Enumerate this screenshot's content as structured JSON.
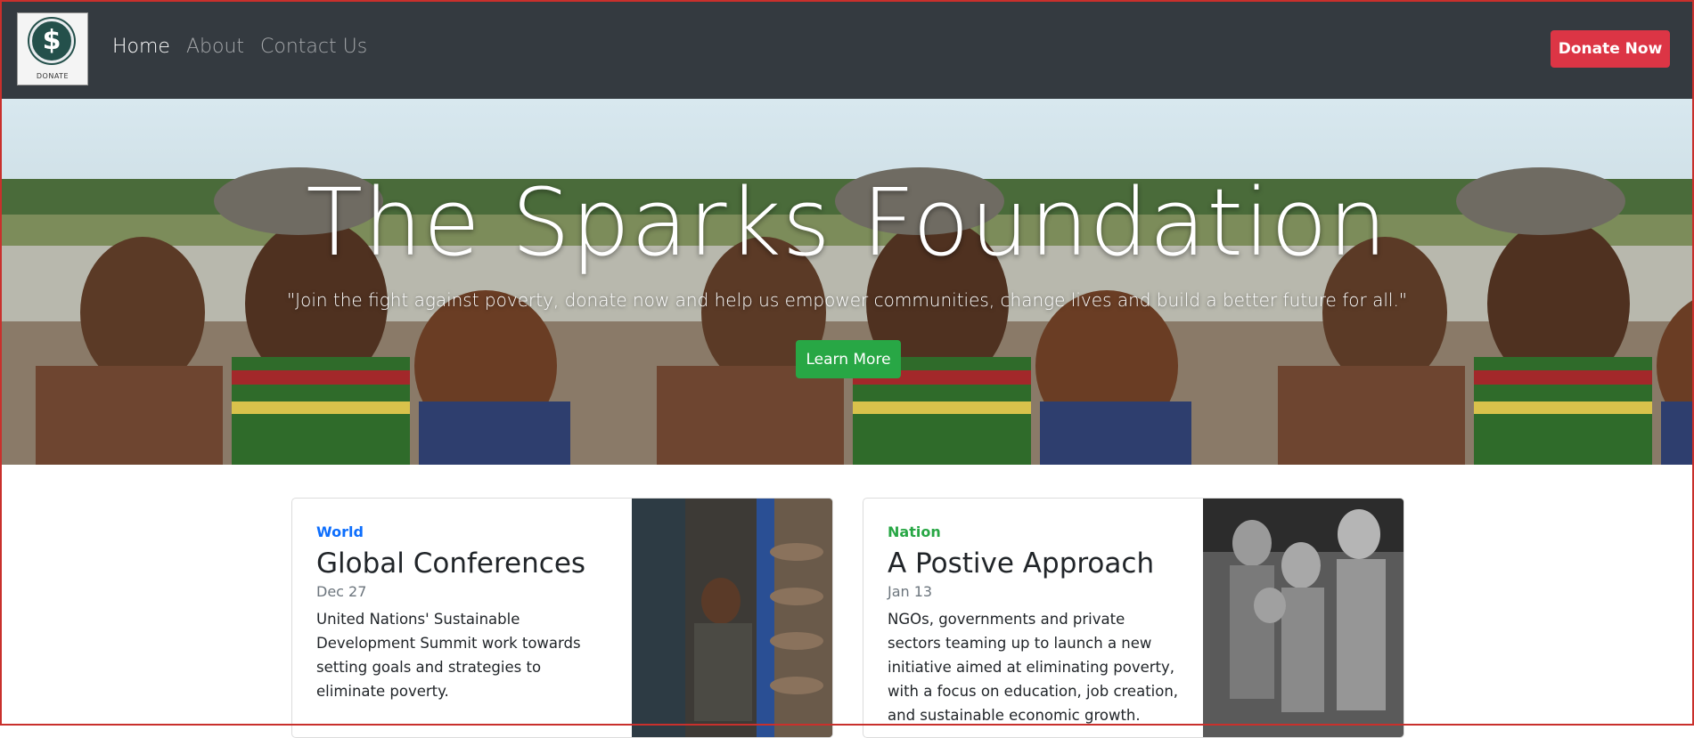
{
  "nav": {
    "logo_caption": "DONATE",
    "logo_symbol": "$",
    "links": [
      {
        "label": "Home",
        "active": true
      },
      {
        "label": "About",
        "active": false
      },
      {
        "label": "Contact Us",
        "active": false
      }
    ],
    "donate_label": "Donate Now"
  },
  "hero": {
    "title": "The Sparks Foundation",
    "subtitle": "\"Join the fight against poverty, donate now and help us empower communities, change lives and build a better future for all.\"",
    "cta_label": "Learn More"
  },
  "cards": [
    {
      "category": "World",
      "category_color": "#0d6efd",
      "title": "Global Conferences",
      "date": "Dec 27",
      "text": "United Nations' Sustainable Development Summit work towards setting goals and strategies to eliminate poverty."
    },
    {
      "category": "Nation",
      "category_color": "#28a745",
      "title": "A Postive Approach",
      "date": "Jan 13",
      "text": "NGOs, governments and private sectors teaming up to launch a new initiative aimed at eliminating poverty, with a focus on education, job creation, and sustainable economic growth."
    }
  ],
  "colors": {
    "navbar_bg": "#343a40",
    "donate_btn": "#dc3545",
    "learn_btn": "#28a745"
  }
}
